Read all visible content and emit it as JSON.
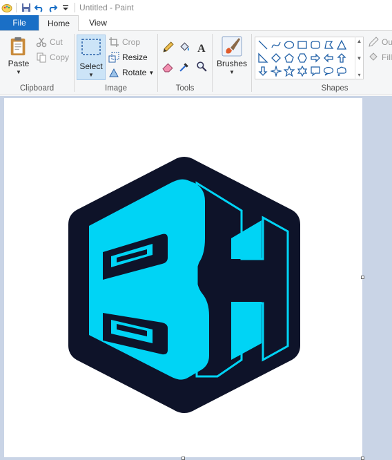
{
  "window": {
    "title": "Untitled - Paint"
  },
  "quick_access": [
    "paint-app-icon",
    "save-icon",
    "undo-icon",
    "redo-icon",
    "customize-dropdown-icon"
  ],
  "tabs": {
    "file": "File",
    "home": "Home",
    "view": "View"
  },
  "clipboard": {
    "paste": "Paste",
    "cut": "Cut",
    "copy": "Copy",
    "label": "Clipboard"
  },
  "image": {
    "select": "Select",
    "crop": "Crop",
    "resize": "Resize",
    "rotate": "Rotate",
    "label": "Image"
  },
  "tools": {
    "label": "Tools",
    "items": [
      "pencil-icon",
      "fill-bucket-icon",
      "text-icon",
      "eraser-icon",
      "color-picker-icon",
      "magnifier-icon"
    ]
  },
  "brushes": {
    "label": "Brushes"
  },
  "shapes": {
    "label": "Shapes",
    "outline": "Ou",
    "fill": "Fill"
  },
  "colors": {
    "accent": "#1a6fc6",
    "logo_cyan": "#00d4f5",
    "logo_dark": "#0e1329",
    "workspace": "#c9d4e6"
  }
}
